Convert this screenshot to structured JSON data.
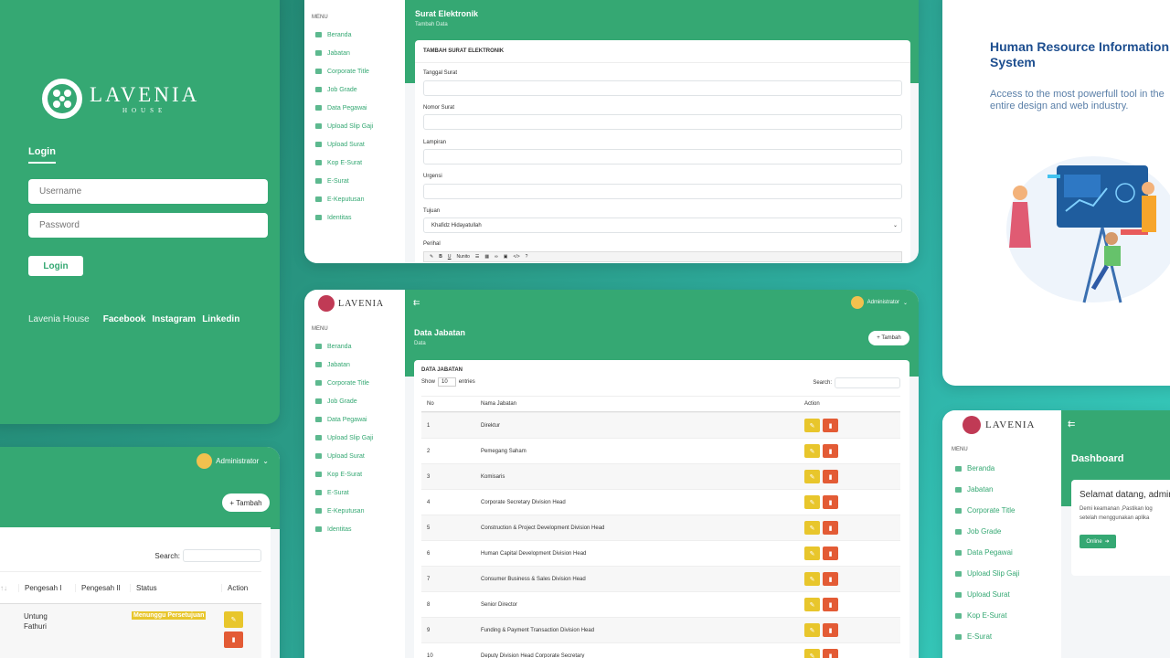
{
  "login": {
    "brand": "LAVENIA",
    "sub": "HOUSE",
    "title": "Login",
    "username_ph": "Username",
    "password_ph": "Password",
    "button": "Login",
    "footer_brand": "Lavenia House",
    "links": [
      "Facebook",
      "Instagram",
      "Linkedin"
    ]
  },
  "menu": {
    "label": "MENU",
    "items": [
      "Beranda",
      "Jabatan",
      "Corporate Title",
      "Job Grade",
      "Data Pegawai",
      "Upload Slip Gaji",
      "Upload Surat",
      "Kop E-Surat",
      "E-Surat",
      "E-Keputusan",
      "Identitas"
    ]
  },
  "surat": {
    "title": "Surat Elektronik",
    "subtitle": "Tambah Data",
    "form_title": "TAMBAH SURAT ELEKTRONIK",
    "fields": [
      "Tanggal Surat",
      "Nomor Surat",
      "Lampiran",
      "Urgensi",
      "Tujuan",
      "Perihal"
    ],
    "tujuan_value": "Khafidz Hidayatullah",
    "toolbar_font": "Nunito"
  },
  "jabatan": {
    "title": "Data Jabatan",
    "subtitle": "Data",
    "add_button": "+ Tambah",
    "admin": "Administrator",
    "table_title": "DATA JABATAN",
    "show": "Show",
    "entries_val": "10",
    "entries": "entries",
    "search": "Search:",
    "headers": [
      "No",
      "Nama Jabatan",
      "Action"
    ],
    "rows": [
      [
        "1",
        "Direktur"
      ],
      [
        "2",
        "Pemegang Saham"
      ],
      [
        "3",
        "Komisaris"
      ],
      [
        "4",
        "Corporate Secretary Division Head"
      ],
      [
        "5",
        "Construction & Project Development Division Head"
      ],
      [
        "6",
        "Human Capital Development Division Head"
      ],
      [
        "7",
        "Consumer Business & Sales Division Head"
      ],
      [
        "8",
        "Senior Director"
      ],
      [
        "9",
        "Funding & Payment Transaction Division Head"
      ],
      [
        "10",
        "Deputy Division Head Corporate Secretary"
      ]
    ]
  },
  "hris": {
    "title": "Human Resource Information System",
    "subtitle": "Access to the most powerfull tool in the entire design and web industry."
  },
  "bottomleft": {
    "admin": "Administrator",
    "add": "+ Tambah",
    "search": "Search:",
    "headers": [
      "Pengesah I",
      "Pengesah II",
      "Status",
      "Action"
    ],
    "row": {
      "name": "Untung Fathuri",
      "status": "Menunggu Persetujuan"
    }
  },
  "dashboard": {
    "brand": "LAVENIA",
    "sub": "HOUSE",
    "menu_label": "MENU",
    "items": [
      "Beranda",
      "Jabatan",
      "Corporate Title",
      "Job Grade",
      "Data Pegawai",
      "Upload Slip Gaji",
      "Upload Surat",
      "Kop E-Surat",
      "E-Surat"
    ],
    "title": "Dashboard",
    "welcome": "Selamat datang, admin",
    "note1": "Demi keamanan ,Pastikan log",
    "note2": "setelah menggunakan aplika",
    "online": "Online"
  }
}
